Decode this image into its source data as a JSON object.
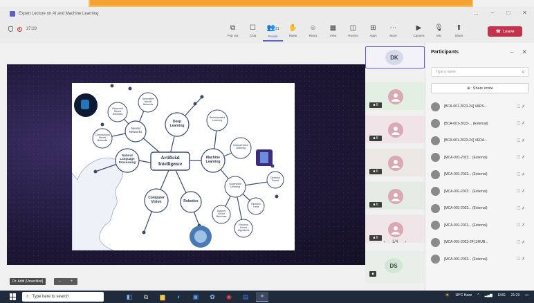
{
  "window": {
    "title": "Expert Lecture on AI and Machine Learning"
  },
  "toolbar": {
    "timer": "37:29",
    "participant_count": "21",
    "items": [
      {
        "label": "Pop out",
        "icon": "popout-icon"
      },
      {
        "label": "Chat",
        "icon": "chat-icon"
      },
      {
        "label": "People",
        "icon": "people-icon"
      },
      {
        "label": "Raise",
        "icon": "raise-hand-icon"
      },
      {
        "label": "React",
        "icon": "react-icon"
      },
      {
        "label": "View",
        "icon": "view-icon"
      },
      {
        "label": "Rooms",
        "icon": "rooms-icon"
      },
      {
        "label": "Apps",
        "icon": "apps-icon"
      },
      {
        "label": "More",
        "icon": "more-icon"
      },
      {
        "label": "Camera",
        "icon": "camera-icon"
      },
      {
        "label": "Mic",
        "icon": "mic-icon"
      },
      {
        "label": "Share",
        "icon": "share-icon"
      }
    ],
    "leave_label": "Leave"
  },
  "slide": {
    "center": "Artificial Intelligence",
    "nodes": [
      {
        "label": "Neural Networks"
      },
      {
        "label": "Deep Learning"
      },
      {
        "label": "Machine Learning"
      },
      {
        "label": "Natural Language Processing"
      },
      {
        "label": "Computer Vision"
      },
      {
        "label": "Robotics"
      },
      {
        "label": "Recurrent Neural Networks"
      },
      {
        "label": "Generative Neural Networks"
      },
      {
        "label": "Convolutional Neural Networks"
      },
      {
        "label": "Reinforcement Learning"
      },
      {
        "label": "Unsupervised Learning"
      },
      {
        "label": "Supervised Learning"
      },
      {
        "label": "Decision Forest"
      },
      {
        "label": "Decision Trees"
      },
      {
        "label": "Support Vector Machines"
      },
      {
        "label": "Random Forest Algorithms"
      }
    ]
  },
  "stage": {
    "presenter_label": "Dr. Aditi (Unverified)"
  },
  "tiles": [
    {
      "initials": "DK"
    },
    {
      "initials": "",
      "mini": "■ II"
    },
    {
      "initials": "",
      "mini": "■ II"
    },
    {
      "initials": "",
      "mini": "■ II"
    },
    {
      "initials": "",
      "mini": "■ II"
    },
    {
      "initials": "",
      "mini": "■ II"
    },
    {
      "initials": "DS"
    }
  ],
  "pager": {
    "prev": "‹",
    "page": "1/4",
    "next": "›"
  },
  "participants_panel": {
    "title": "Participants",
    "search_placeholder": "Type a name",
    "invite_label": "Share invite",
    "list": [
      {
        "name": "[BCA-001-2023-24] VARS...",
        "tag": ""
      },
      {
        "name": "[BCA-001-2023-...",
        "tag": "(External)"
      },
      {
        "name": "[BCA-001-2023-24] VEDA...",
        "tag": ""
      },
      {
        "name": "[MCA-001-2023...",
        "tag": "(External)"
      },
      {
        "name": "[MCA-001-2023...",
        "tag": "(External)"
      },
      {
        "name": "[MCA-001-2023...",
        "tag": "(External)"
      },
      {
        "name": "[MCA-001-2023...",
        "tag": "(External)"
      },
      {
        "name": "[MCA-001-2023...",
        "tag": "(External)"
      },
      {
        "name": "[MCA-001-2023-24] SHUB...",
        "tag": ""
      },
      {
        "name": "[MCA-001-2023...",
        "tag": "(External)"
      }
    ]
  },
  "taskbar": {
    "search_placeholder": "Type here to search",
    "weather": "18°C Haze",
    "lang": "ENG",
    "time": "21:23"
  }
}
